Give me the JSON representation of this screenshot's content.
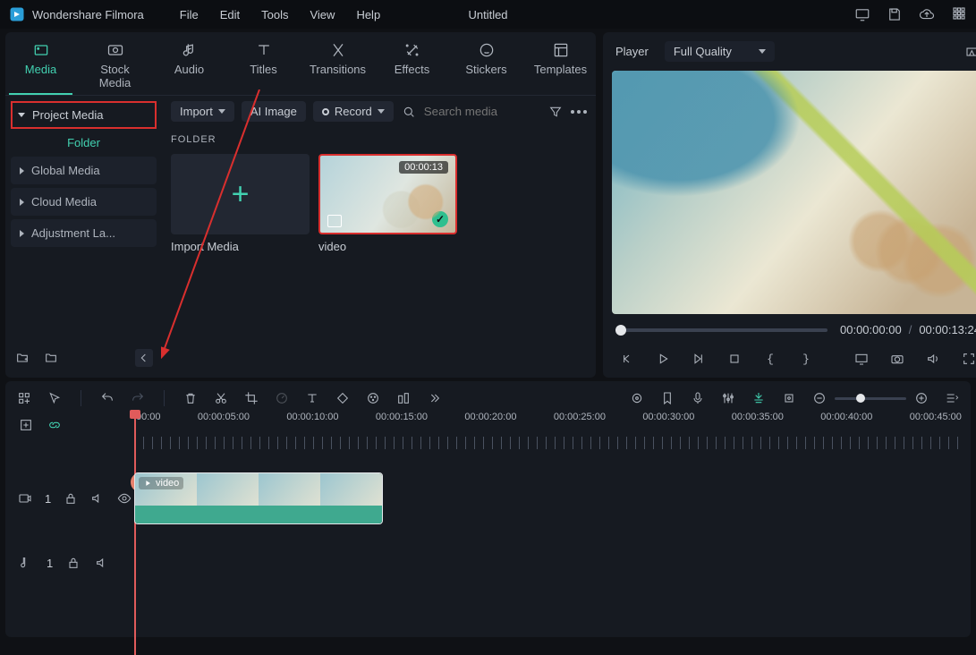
{
  "app": {
    "name": "Wondershare Filmora"
  },
  "menu": {
    "file": "File",
    "edit": "Edit",
    "tools": "Tools",
    "view": "View",
    "help": "Help"
  },
  "document": {
    "title": "Untitled"
  },
  "tabs": {
    "media": "Media",
    "stock": "Stock Media",
    "audio": "Audio",
    "titles": "Titles",
    "transitions": "Transitions",
    "effects": "Effects",
    "stickers": "Stickers",
    "templates": "Templates"
  },
  "sidebar": {
    "project_media": "Project Media",
    "folder": "Folder",
    "items": {
      "global": "Global Media",
      "cloud": "Cloud Media",
      "adjust": "Adjustment La..."
    }
  },
  "browser": {
    "import": "Import",
    "ai_image": "AI Image",
    "record": "Record",
    "search_placeholder": "Search media",
    "folder_header": "FOLDER",
    "import_media_label": "Import Media",
    "video_label": "video",
    "video_duration": "00:00:13"
  },
  "preview": {
    "player": "Player",
    "quality": "Full Quality",
    "current": "00:00:00:00",
    "total": "00:00:13:24"
  },
  "ruler": {
    "t0": "00:00",
    "t1": "00:00:05:00",
    "t2": "00:00:10:00",
    "t3": "00:00:15:00",
    "t4": "00:00:20:00",
    "t5": "00:00:25:00",
    "t6": "00:00:30:00",
    "t7": "00:00:35:00",
    "t8": "00:00:40:00",
    "t9": "00:00:45:00"
  },
  "track": {
    "video_index": "1",
    "audio_index": "1",
    "clip_label": "video"
  }
}
